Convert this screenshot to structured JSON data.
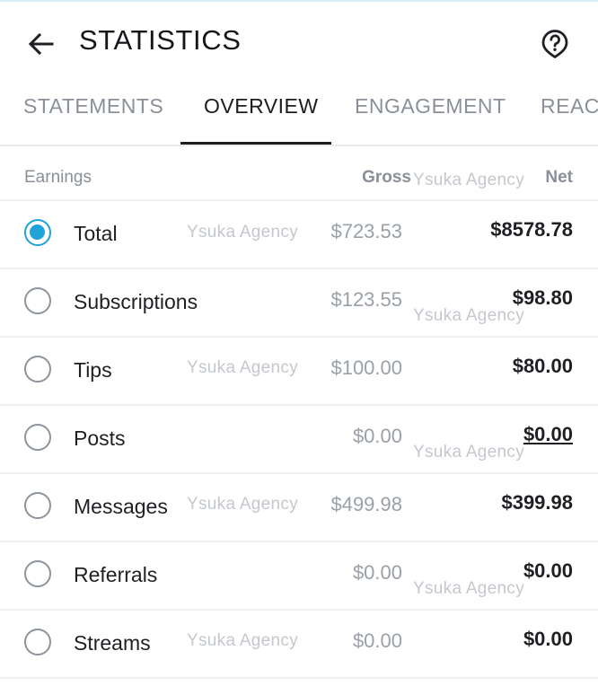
{
  "header": {
    "title": "STATISTICS",
    "back_icon": "arrow-left-icon",
    "help_icon": "question-circle-icon"
  },
  "tabs": [
    {
      "label": "STATEMENTS",
      "active": false
    },
    {
      "label": "OVERVIEW",
      "active": true
    },
    {
      "label": "ENGAGEMENT",
      "active": false
    },
    {
      "label": "REACH",
      "active": false
    }
  ],
  "columns": {
    "earnings": "Earnings",
    "gross": "Gross",
    "net": "Net"
  },
  "rows": [
    {
      "label": "Total",
      "gross": "$723.53",
      "net": "$8578.78",
      "selected": true
    },
    {
      "label": "Subscriptions",
      "gross": "$123.55",
      "net": "$98.80",
      "selected": false
    },
    {
      "label": "Tips",
      "gross": "$100.00",
      "net": "$80.00",
      "selected": false
    },
    {
      "label": "Posts",
      "gross": "$0.00",
      "net": "$0.00",
      "selected": false
    },
    {
      "label": "Messages",
      "gross": "$499.98",
      "net": "$399.98",
      "selected": false
    },
    {
      "label": "Referrals",
      "gross": "$0.00",
      "net": "$0.00",
      "selected": false
    },
    {
      "label": "Streams",
      "gross": "$0.00",
      "net": "$0.00",
      "selected": false
    }
  ],
  "watermark": "Ysuka Agency",
  "colors": {
    "accent": "#21a3d8",
    "text": "#1f2024",
    "muted": "#8a9098"
  }
}
